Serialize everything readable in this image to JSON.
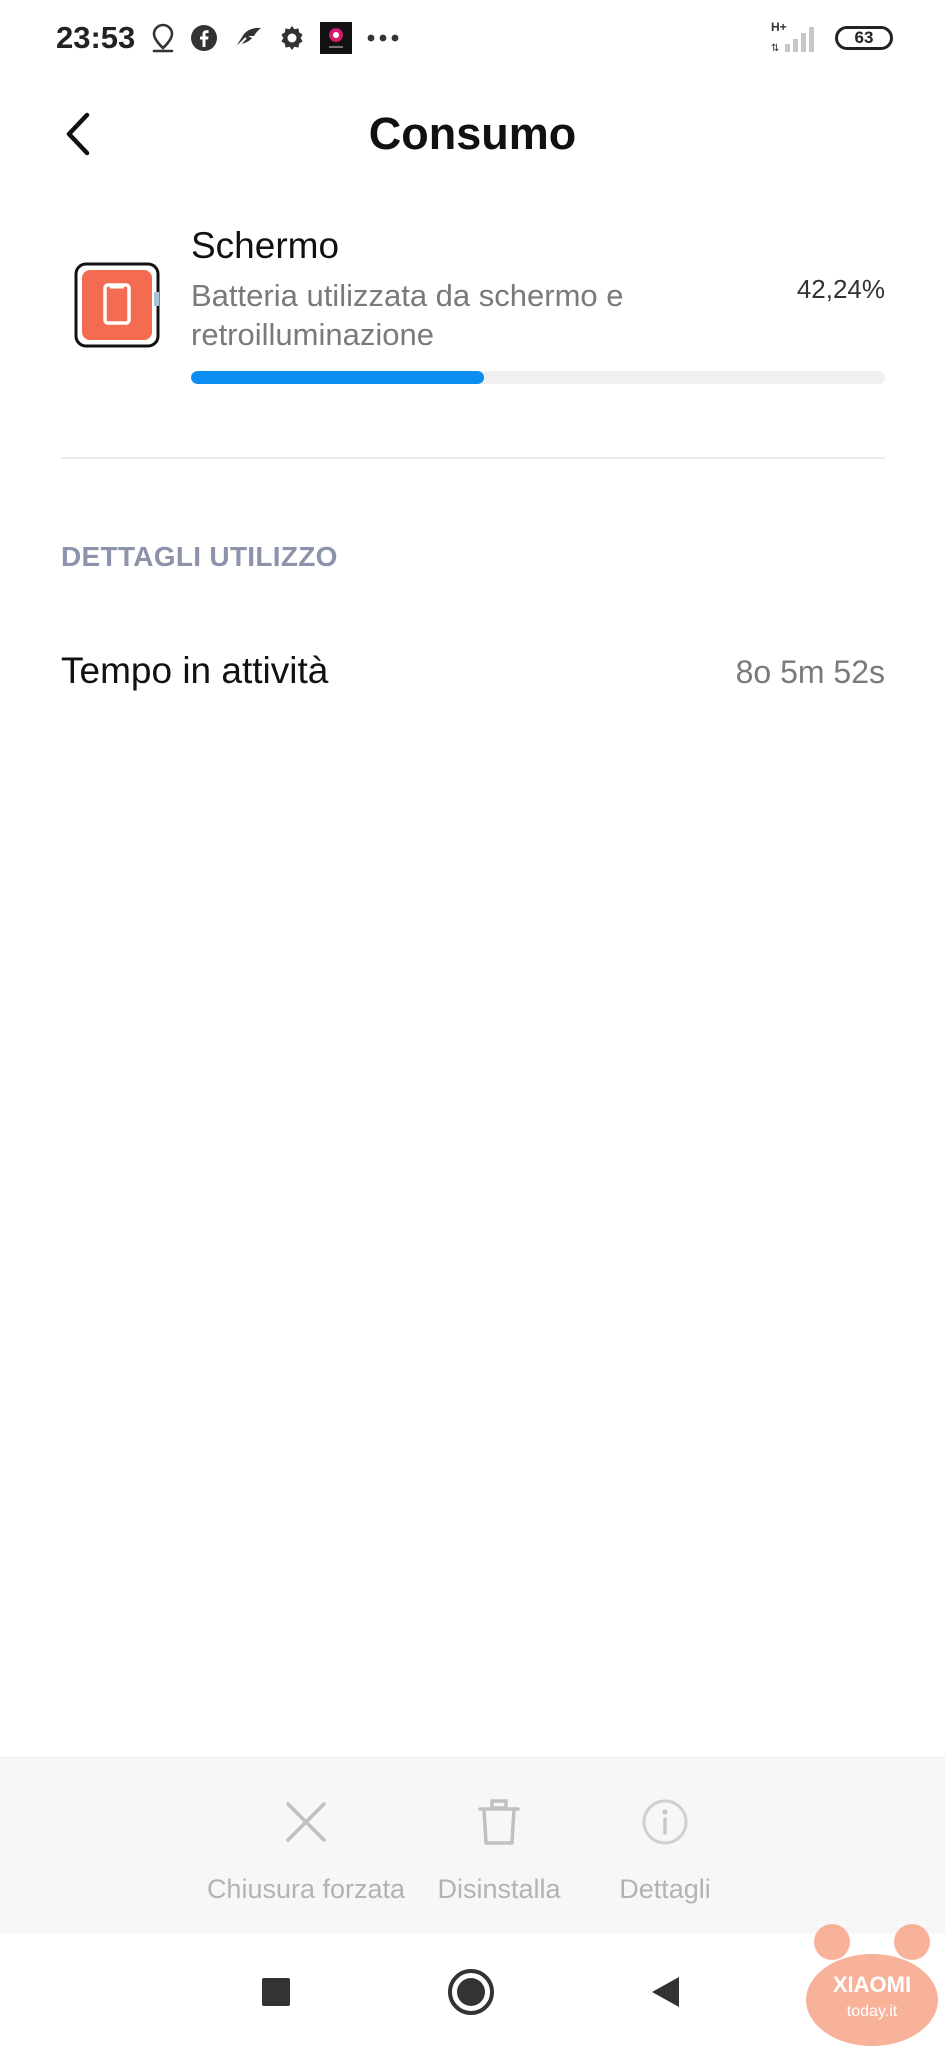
{
  "status_bar": {
    "time": "23:53",
    "network": "H+",
    "battery": "63",
    "notification_icons": [
      "location-icon",
      "facebook-icon",
      "feather-icon",
      "gear-icon",
      "app-icon",
      "more-icon"
    ]
  },
  "header": {
    "title": "Consumo",
    "back_icon": "chevron-left-icon"
  },
  "item": {
    "title": "Schermo",
    "description": "Batteria utilizzata da schermo e retroilluminazione",
    "percent": "42,24%",
    "usage_fraction": 0.4224,
    "accent_color": "#0b8ef2",
    "icon_color": "#f36b50"
  },
  "usage_details": {
    "header": "DETTAGLI UTILIZZO",
    "rows": [
      {
        "label": "Tempo in attività",
        "value": "8o 5m 52s"
      }
    ]
  },
  "actions": {
    "force_stop": "Chiusura forzata",
    "uninstall": "Disinstalla",
    "details": "Dettagli"
  },
  "watermark": {
    "brand": "XIAOMI",
    "domain": "today.it"
  }
}
